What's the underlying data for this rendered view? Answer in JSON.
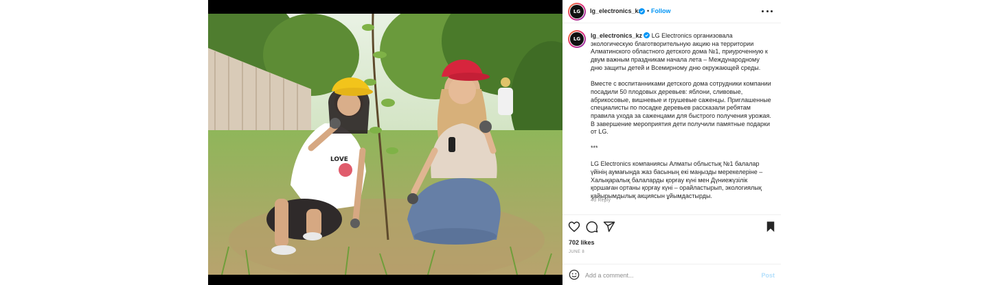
{
  "post": {
    "username": "lg_electronics_kz",
    "avatar_text": "LG",
    "follow_label": "Follow",
    "separator": "•",
    "caption": "LG Electronics организовала экологическую благотворительную акцию на территории Алматинского областного детского дома №1, приуроченную к двум важным праздникам начала лета – Международному дню защиты детей и Всемирному дню окружающей среды.\n\nВместе с воспитанниками детского дома сотрудники компании посадили 50 плодовых деревьев: яблони, сливовые, абрикосовые, вишневые и грушевые саженцы. Приглашенные специалисты по посадке деревьев рассказали ребятам правила ухода за саженцами для быстрого получения урожая. В завершение мероприятия дети получили памятные подарки от LG.\n\n***\n\nLG Electronics компаниясы Алматы облыстық №1 балалар үйінің аумағында жаз басының екі маңызды мерекелеріне – Халықаралық балаларды қорғау күні мен Дүниежүзілік қоршаған ортаны қорғау күні – орайластырып, экологиялық қайырымдылық акциясын ұйымдастырды.",
    "caption_meta": "4d   Reply",
    "likes": "702 likes",
    "date": "JUNE 8"
  },
  "comment": {
    "placeholder": "Add a comment...",
    "post_label": "Post"
  },
  "colors": {
    "accent": "#0095f6",
    "post_disabled": "#b2dffc",
    "muted": "#8e8e8e",
    "text": "#262626"
  },
  "icons": [
    "heart-icon",
    "comment-icon",
    "share-icon",
    "bookmark-icon",
    "emoji-icon",
    "more-icon",
    "verified-icon"
  ]
}
